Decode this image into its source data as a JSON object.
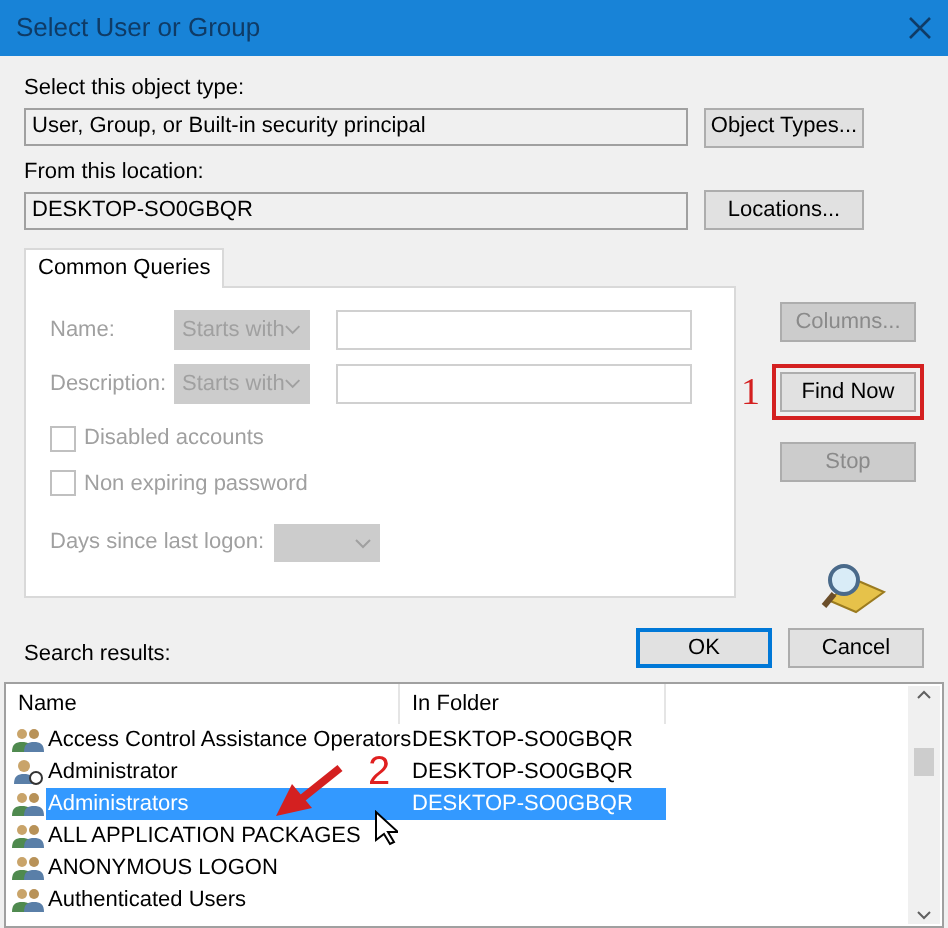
{
  "window": {
    "title": "Select User or Group"
  },
  "object_type": {
    "label": "Select this object type:",
    "value": "User, Group, or Built-in security principal",
    "button": "Object Types..."
  },
  "location": {
    "label": "From this location:",
    "value": "DESKTOP-SO0GBQR",
    "button": "Locations..."
  },
  "tabs": [
    {
      "label": "Common Queries",
      "selected": true
    }
  ],
  "queries": [
    {
      "label": "Name:",
      "operator": "Starts with"
    },
    {
      "label": "Description:",
      "operator": "Starts with"
    }
  ],
  "checkboxes": [
    {
      "label": "Disabled accounts",
      "checked": false
    },
    {
      "label": "Non expiring password",
      "checked": false
    }
  ],
  "days": {
    "label": "Days since last logon:"
  },
  "side_buttons": [
    {
      "label": "Columns...",
      "disabled": true,
      "highlighted": false
    },
    {
      "label": "Find Now",
      "disabled": false,
      "highlighted": true
    },
    {
      "label": "Stop",
      "disabled": true,
      "highlighted": false
    }
  ],
  "annotations": [
    "1",
    "2"
  ],
  "dialog_buttons": [
    {
      "label": "OK",
      "default": true
    },
    {
      "label": "Cancel",
      "default": false
    }
  ],
  "results": {
    "label": "Search results:",
    "columns": [
      "Name",
      "In Folder"
    ],
    "rows": [
      {
        "name": "Access Control Assistance Operators",
        "folder": "DESKTOP-SO0GBQR",
        "kind": "group",
        "selected": false
      },
      {
        "name": "Administrator",
        "folder": "DESKTOP-SO0GBQR",
        "kind": "user",
        "selected": false
      },
      {
        "name": "Administrators",
        "folder": "DESKTOP-SO0GBQR",
        "kind": "group",
        "selected": true
      },
      {
        "name": "ALL APPLICATION PACKAGES",
        "folder": "",
        "kind": "group",
        "selected": false
      },
      {
        "name": "ANONYMOUS LOGON",
        "folder": "",
        "kind": "group",
        "selected": false
      },
      {
        "name": "Authenticated Users",
        "folder": "",
        "kind": "group",
        "selected": false
      }
    ]
  }
}
